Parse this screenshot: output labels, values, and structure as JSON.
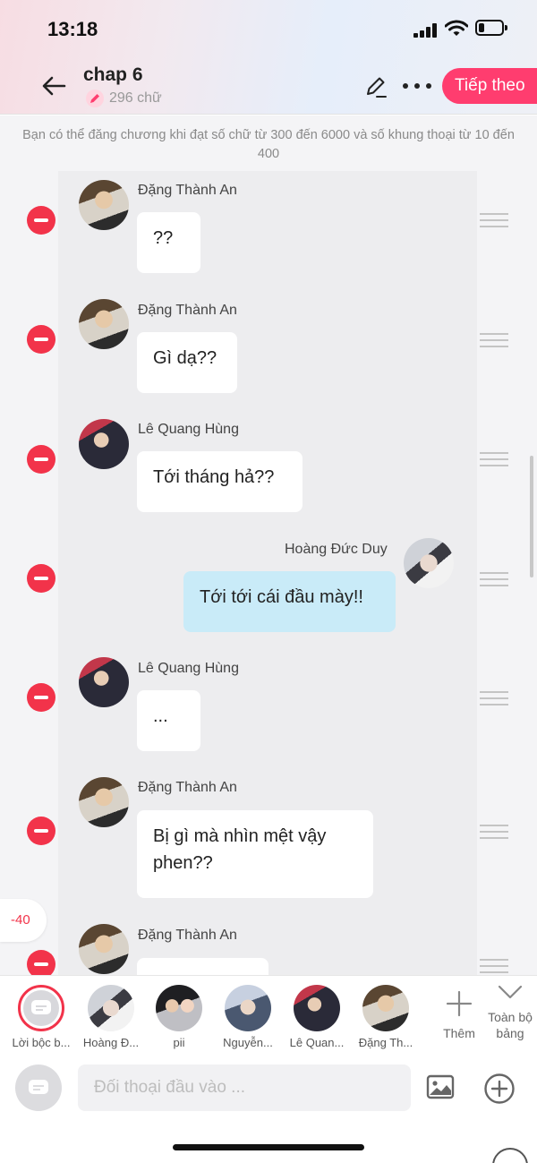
{
  "status_bar": {
    "time": "13:18"
  },
  "header": {
    "title": "chap 6",
    "word_count": "296 chữ",
    "next_label": "Tiếp theo",
    "accent": "#ff3d6f"
  },
  "notice": "Bạn có thể đăng chương khi đạt số chữ từ 300 đến 6000 và số khung thoại từ 10 đến 400",
  "messages": [
    {
      "speaker": "Đặng Thành An",
      "text": "??",
      "side": "left"
    },
    {
      "speaker": "Đặng Thành An",
      "text": "Gì dạ??",
      "side": "left"
    },
    {
      "speaker": "Lê Quang Hùng",
      "text": "Tới tháng hả??",
      "side": "left"
    },
    {
      "speaker": "Hoàng Đức Duy",
      "text": "Tới tới cái đầu mày!!",
      "side": "right"
    },
    {
      "speaker": "Lê Quang Hùng",
      "text": "...",
      "side": "left"
    },
    {
      "speaker": "Đặng Thành An",
      "text": "Bị gì mà nhìn mệt vậy phen??",
      "side": "left"
    },
    {
      "speaker": "Đặng Thành An",
      "text": "",
      "side": "left"
    }
  ],
  "counter": "-40",
  "characters": [
    {
      "label": "Lời bộc b..."
    },
    {
      "label": "Hoàng Đ..."
    },
    {
      "label": "pii"
    },
    {
      "label": "Nguyễn..."
    },
    {
      "label": "Lê Quan..."
    },
    {
      "label": "Đặng Th..."
    }
  ],
  "more_label": "Thêm",
  "all_label": "Toàn bộ bảng",
  "input": {
    "placeholder": "Đối thoại đầu vào ..."
  },
  "colors": {
    "delete": "#f2334a",
    "my_bubble": "#c9ebf8"
  }
}
